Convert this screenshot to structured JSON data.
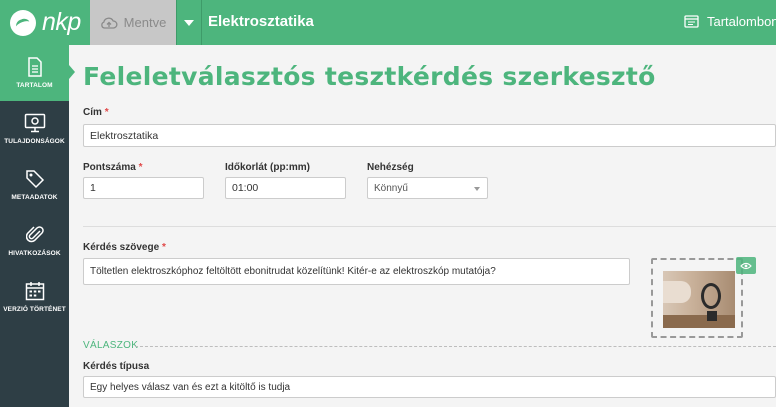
{
  "app": {
    "logo_text": "nkp",
    "brand_color": "#4db57d",
    "sidebar_color": "#2e3e45"
  },
  "topbar": {
    "save_label": "Mentve",
    "document_title": "Elektrosztatika",
    "toc_label": "Tartalombong"
  },
  "sidebar": {
    "items": [
      {
        "label": "TARTALOM",
        "icon": "document-icon",
        "active": true
      },
      {
        "label": "TULAJDONSÁGOK",
        "icon": "monitor-gear-icon",
        "active": false
      },
      {
        "label": "METAADATOK",
        "icon": "tag-icon",
        "active": false
      },
      {
        "label": "HIVATKOZÁSOK",
        "icon": "paperclip-icon",
        "active": false
      },
      {
        "label": "VERZIÓ TÖRTÉNET",
        "icon": "calendar-icon",
        "active": false
      }
    ]
  },
  "page": {
    "title": "Feleletválasztós tesztkérdés szerkesztő"
  },
  "form": {
    "title_label": "Cím",
    "title_value": "Elektrosztatika",
    "points_label": "Pontszáma",
    "points_value": "1",
    "time_label": "Időkorlát (pp:mm)",
    "time_value": "01:00",
    "difficulty_label": "Nehézség",
    "difficulty_value": "Könnyű",
    "question_label": "Kérdés szövege",
    "question_value": "Töltetlen elektroszkóphoz feltöltött ebonitrudat közelítünk! Kitér-e az elektroszkóp mutatója?",
    "required_mark": "*"
  },
  "answers": {
    "section_label": "VÁLASZOK",
    "type_label": "Kérdés típusa",
    "type_value": "Egy helyes válasz van és ezt a kitöltő is tudja"
  }
}
